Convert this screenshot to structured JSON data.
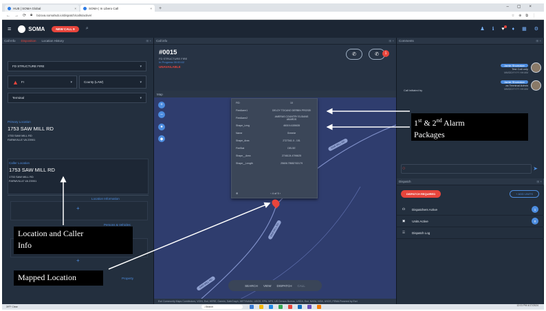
{
  "browser": {
    "tabs": [
      {
        "label": "HUB | SOMA Global"
      },
      {
        "label": "SOMA | In Libero Call"
      }
    ],
    "url": "bizova.somahub.io/dispatch/calls/active/"
  },
  "app": {
    "brand": "SOMA",
    "new_call_label": "NEW CALL 9"
  },
  "left_panel": {
    "tabs": [
      "Call Info",
      "Disposition",
      "Location History"
    ],
    "call_type": "FD STRUCTURE FIRE",
    "priority": "FI",
    "jurisdiction": "County (LAW)",
    "terminal": "Terminal",
    "primary_location": {
      "label": "Primary Location",
      "address": "1753 SAW MILL RD",
      "line2": "1753 SAW MILL RD",
      "line3": "FARMVILLE VA 23901"
    },
    "caller_location": {
      "label": "Caller Location",
      "address": "1753 SAW MILL RD",
      "line2": "1753 SAW MILL RD",
      "line3": "FARMVILLE VA 23901"
    },
    "location_information_label": "Location Information",
    "persons_label": "Persons & Vehicles",
    "property_label": "Property"
  },
  "call": {
    "tab": "Call info",
    "number": "#0015",
    "type": "FD STRUCTURE FIRE",
    "status": "In Progress 00:00:02",
    "unavailable": "UNAVAILABLE",
    "badge": "1"
  },
  "map": {
    "tab": "Map",
    "popup_rows": [
      {
        "k": "FID",
        "v": "10"
      },
      {
        "k": "FireAlarm1",
        "v": "DELOY TOCANO DERBIN PROSEI"
      },
      {
        "k": "FireAlarm2",
        "v": "AMERAS COUNTRY ELSIANS ABARDS"
      },
      {
        "k": "Shape_Leng",
        "v": "46019.4155635"
      },
      {
        "k": "Name",
        "v": "Greenie"
      },
      {
        "k": "Shape_Area",
        "v": "2727341.0 - 151"
      },
      {
        "k": "FireStat",
        "v": "DELSE"
      },
      {
        "k": "Shape__Area",
        "v": "2746124.4796625"
      },
      {
        "k": "Shape__Length",
        "v": "25606.75582763179"
      }
    ],
    "pager": "4 of 5",
    "road_labels": [
      "SAW MILL RD",
      "SAW MILL RD",
      "SAW MILL RD"
    ],
    "bar": [
      "SEARCH",
      "VIEW",
      "DISPATCH",
      "CALL"
    ],
    "attribution": "Esri Community Maps Contributors, VGIN, Esri, HERE, Garmin, SafeGraph, METI/NASA, USGS, EPA, NPS, US Census Bureau, USDA, Esri, NASA, NGA, USGS, FEMA   Powered by Esri"
  },
  "comments": {
    "tab": "Comments",
    "entries": [
      {
        "name": "Jamie Shumaker",
        "text": "Test Call only",
        "meta": "MM/DD/YYYY HH:MM"
      },
      {
        "name": "Jamie Shumaker",
        "text": "as Terminal Admin",
        "meta": "MM/DD/YYYY HH:MM"
      }
    ],
    "initiated_by": "Call initiated by"
  },
  "dispatch": {
    "tab": "Dispatch",
    "dispatch_btn": "DISPATCH REQUIRED",
    "add_btn": "+ ADD UNITS",
    "rows": [
      {
        "label": "Dispatchers Active",
        "count": "1"
      },
      {
        "label": "Units Active",
        "count": "0"
      },
      {
        "label": "Dispatch Log",
        "count": ""
      }
    ]
  },
  "taskbar": {
    "weather": "39°F Clear",
    "search": "Search",
    "time": "12:01 PM",
    "date": "4/17/2024"
  },
  "annotations": {
    "alarm": "1st & 2nd Alarm Packages",
    "alarm_line1": "1",
    "alarm_sup1": "st",
    "alarm_mid": " & 2",
    "alarm_sup2": "nd",
    "alarm_rest": " Alarm",
    "alarm_line2": "Packages",
    "location_line1": "Location and Caller",
    "location_line2": "Info",
    "mapped": "Mapped Location"
  },
  "colors": {
    "accent_blue": "#4d8de0",
    "alert_red": "#e8453c",
    "panel_bg": "#232f3e",
    "map_bg": "#2f3d6e"
  }
}
